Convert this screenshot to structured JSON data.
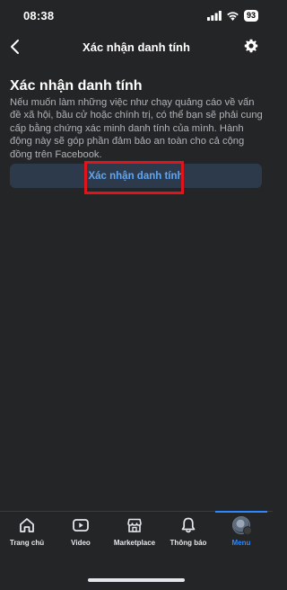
{
  "status_bar": {
    "time": "08:38",
    "battery": "93",
    "signal_icon": "cellular-signal-icon",
    "wifi_icon": "wifi-icon"
  },
  "header": {
    "title": "Xác nhận danh tính",
    "back_icon": "chevron-left-icon",
    "settings_icon": "gear-icon"
  },
  "main": {
    "heading": "Xác nhận danh tính",
    "description": "Nếu muốn làm những việc như chạy quảng cáo về vấn đề xã hội, bầu cử hoặc chính trị, có thể bạn sẽ phải cung cấp bằng chứng xác minh danh tính của mình. Hành động này sẽ góp phần đảm bảo an toàn cho cả cộng đồng trên Facebook.",
    "button_label": "Xác nhận danh tính"
  },
  "bottom_nav": {
    "items": [
      {
        "label": "Trang chủ",
        "icon": "home-icon"
      },
      {
        "label": "Video",
        "icon": "video-icon"
      },
      {
        "label": "Marketplace",
        "icon": "marketplace-icon"
      },
      {
        "label": "Thông báo",
        "icon": "bell-icon"
      },
      {
        "label": "Menu",
        "icon": "avatar-icon",
        "active": true
      }
    ]
  },
  "colors": {
    "background": "#242526",
    "accent": "#2d88ff",
    "button_bg": "#2d3a4b",
    "highlight": "#e1131b"
  }
}
